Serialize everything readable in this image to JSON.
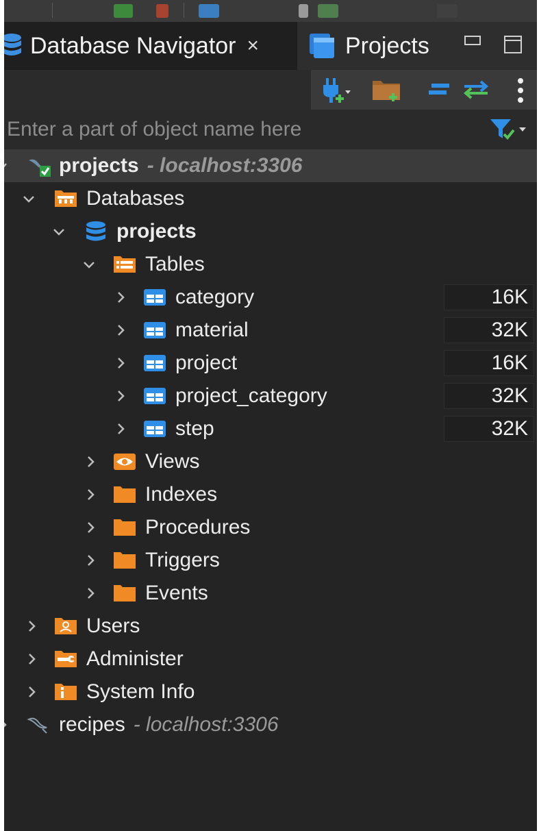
{
  "tabs": {
    "database_navigator": {
      "label": "Database Navigator",
      "close_symbol": "×"
    },
    "projects": {
      "label": "Projects"
    }
  },
  "filter": {
    "placeholder": "Enter a part of object name here"
  },
  "toolbar_icons": [
    "new-connection-icon",
    "new-folder-icon",
    "collapse-all-icon",
    "link-with-editor-icon",
    "more-menu-icon"
  ],
  "tree": {
    "connection": {
      "name": "projects",
      "host": "- localhost:3306"
    },
    "databases_label": "Databases",
    "database": {
      "name": "projects"
    },
    "tables_label": "Tables",
    "tables": [
      {
        "name": "category",
        "size": "16K"
      },
      {
        "name": "material",
        "size": "32K"
      },
      {
        "name": "project",
        "size": "16K"
      },
      {
        "name": "project_category",
        "size": "32K"
      },
      {
        "name": "step",
        "size": "32K"
      }
    ],
    "folders": [
      "Views",
      "Indexes",
      "Procedures",
      "Triggers",
      "Events"
    ],
    "users_label": "Users",
    "administer_label": "Administer",
    "system_info_label": "System Info",
    "connection2": {
      "name": "recipes",
      "host": "- localhost:3306"
    }
  },
  "colors": {
    "accent_orange": "#f08a24",
    "table_blue": "#2f8fe6",
    "selected_row": "#3b3b3b"
  }
}
